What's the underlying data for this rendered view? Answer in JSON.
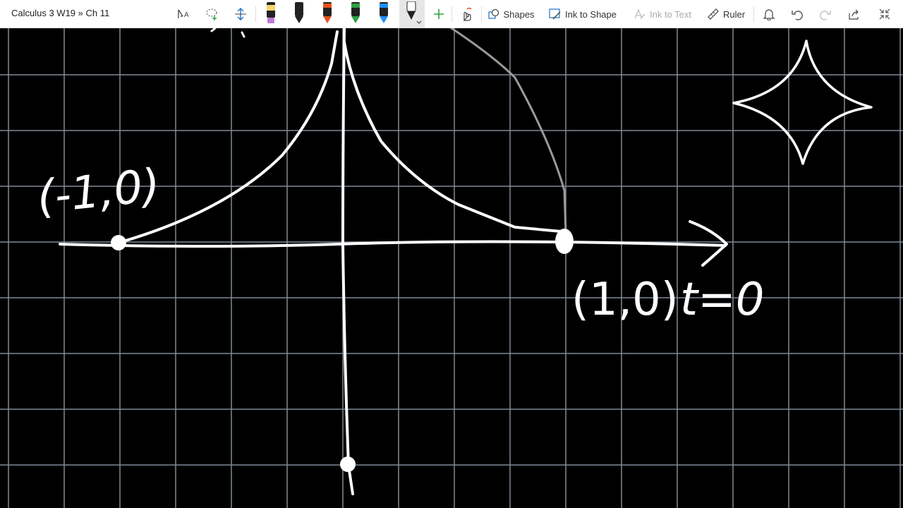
{
  "app": {
    "breadcrumb": "Calculus 3 W19 » Ch 11"
  },
  "toolbar": {
    "shapes_label": "Shapes",
    "ink_to_shape_label": "Ink to Shape",
    "ink_to_text_label": "Ink to Text",
    "ruler_label": "Ruler",
    "pens": [
      {
        "name": "pen-highlighter-yellow",
        "color": "#f6d36b",
        "tip": "#c07ad9"
      },
      {
        "name": "pen-black",
        "color": "#222222"
      },
      {
        "name": "pen-orange",
        "color": "#e8501e"
      },
      {
        "name": "pen-green",
        "color": "#2ea043"
      },
      {
        "name": "pen-blue",
        "color": "#1e90ff"
      },
      {
        "name": "pen-white-selected",
        "color": "#ffffff"
      }
    ],
    "icons": [
      "select-text-icon",
      "lasso-select-icon",
      "add-space-icon",
      "add-pen-icon",
      "touch-draw-icon",
      "shapes-icon",
      "ink-to-shape-icon",
      "ink-to-text-icon",
      "ruler-icon",
      "bell-icon",
      "undo-icon",
      "redo-icon",
      "share-icon",
      "exit-fullscreen-icon"
    ]
  },
  "canvas": {
    "background": "#000000",
    "grid_color": "#7f8a96",
    "ink_color": "#ffffff",
    "annotations": {
      "left_point": "(-1,0)",
      "right_point": "(1,0)",
      "param": "t=0"
    }
  }
}
